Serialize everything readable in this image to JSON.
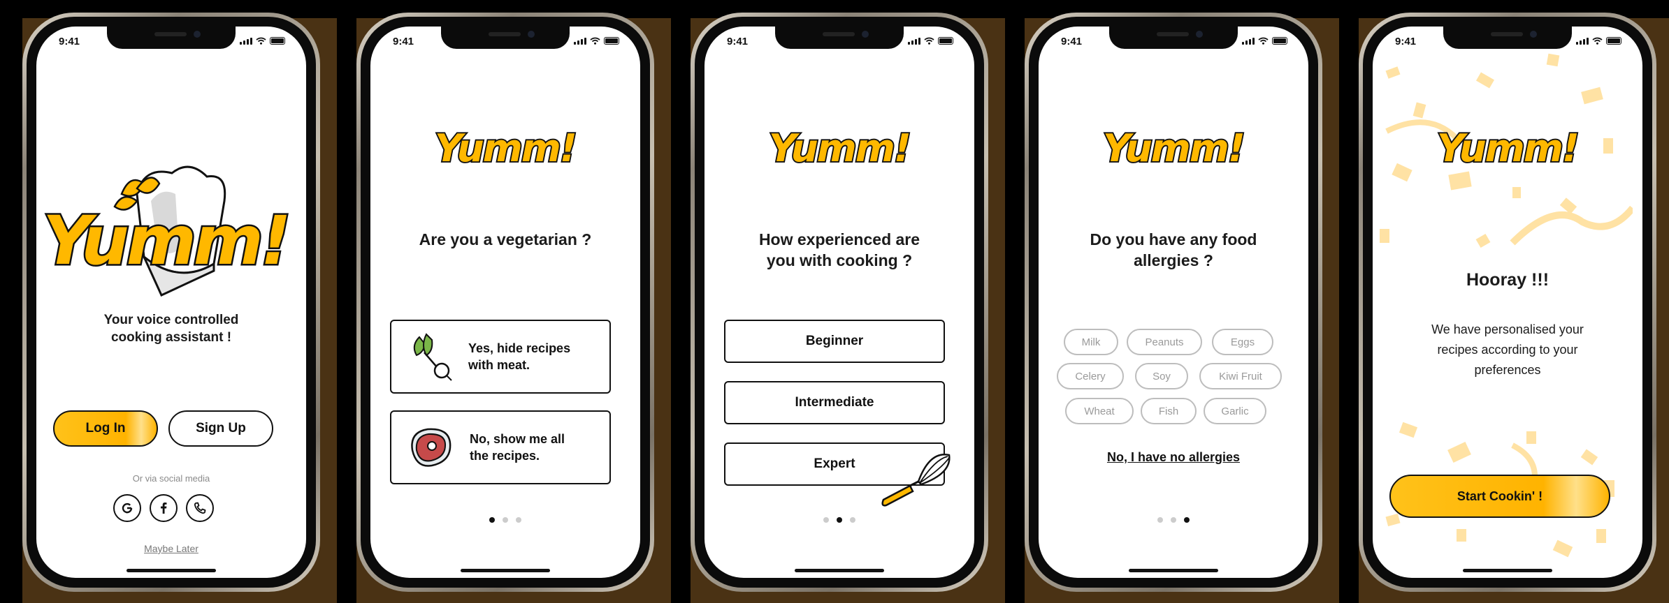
{
  "status": {
    "time": "9:41"
  },
  "brand": {
    "logo_text": "Yumm!"
  },
  "colors": {
    "accent": "#ffb800",
    "outline": "#111111",
    "bezel_shadow": "#4a3214",
    "confetti": "#ffe2a4"
  },
  "screen1": {
    "tagline_line1": "Your voice controlled",
    "tagline_line2": "cooking assistant !",
    "login_label": "Log In",
    "signup_label": "Sign Up",
    "social_caption": "Or via social media",
    "social_icons": [
      "google-icon",
      "facebook-icon",
      "phone-icon"
    ],
    "maybe_later": "Maybe Later"
  },
  "screen2": {
    "question": "Are you a vegetarian ?",
    "option_yes": {
      "line1": "Yes, hide recipes",
      "line2": "with meat.",
      "icon": "radish-icon"
    },
    "option_no": {
      "line1": "No, show me all",
      "line2": "the recipes.",
      "icon": "steak-icon"
    },
    "page_index": 0,
    "page_count": 3
  },
  "screen3": {
    "question_line1": "How experienced are",
    "question_line2": "you with cooking ?",
    "levels": [
      "Beginner",
      "Intermediate",
      "Expert"
    ],
    "page_index": 1,
    "page_count": 3
  },
  "screen4": {
    "question_line1": "Do you have any food",
    "question_line2": "allergies ?",
    "allergens": [
      "Milk",
      "Peanuts",
      "Eggs",
      "Celery",
      "Soy",
      "Kiwi Fruit",
      "Wheat",
      "Fish",
      "Garlic"
    ],
    "no_allergies_link": "No, I have no allergies",
    "page_index": 2,
    "page_count": 3
  },
  "screen5": {
    "heading": "Hooray !!!",
    "message_line1": "We have personalised your",
    "message_line2": "recipes according to your",
    "message_line3": "preferences",
    "cta_label": "Start Cookin' !"
  }
}
